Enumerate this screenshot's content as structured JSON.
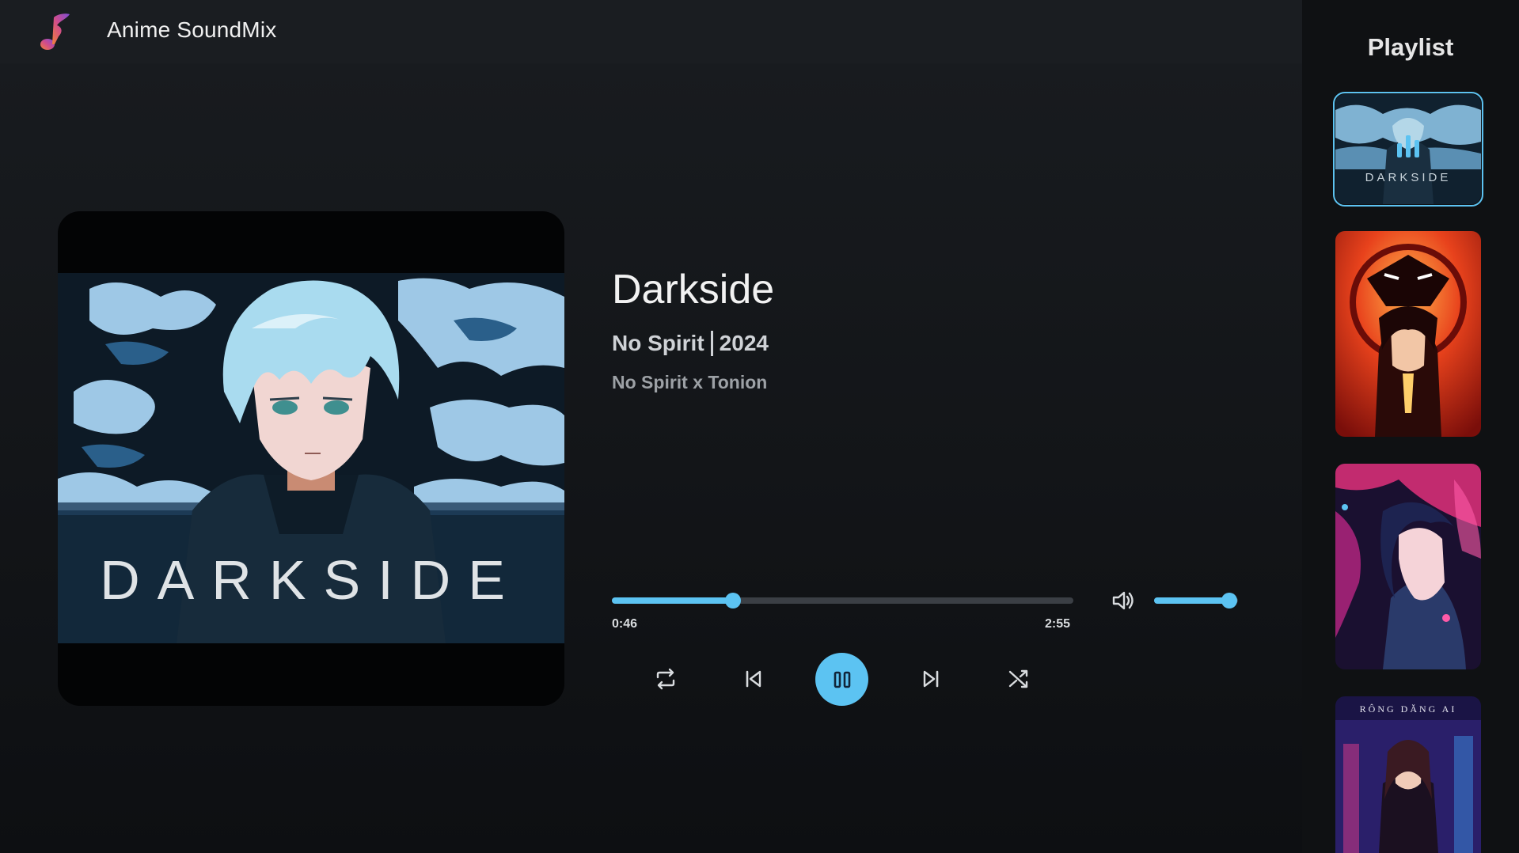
{
  "app": {
    "title": "Anime SoundMix"
  },
  "track": {
    "title": "Darkside",
    "artist": "No Spirit",
    "year": "2024",
    "credits": "No Spirit x Tonion",
    "cover_text": "DARKSIDE"
  },
  "player": {
    "current_time": "0:46",
    "total_time": "2:55",
    "progress_fraction": 0.263,
    "volume_fraction": 0.9,
    "state": "playing"
  },
  "playlist": {
    "title": "Playlist",
    "items": [
      {
        "cover_text": "DARKSIDE",
        "active": true,
        "now_playing_icon": "equalizer-icon"
      },
      {
        "cover_text": "",
        "active": false
      },
      {
        "cover_text": "",
        "active": false
      },
      {
        "cover_text": "RÔNG DĂNG AI",
        "active": false
      }
    ]
  },
  "icons": {
    "repeat": "repeat-icon",
    "previous": "skip-previous-icon",
    "pause": "pause-icon",
    "next": "skip-next-icon",
    "shuffle": "shuffle-icon",
    "volume": "volume-icon"
  },
  "colors": {
    "accent": "#5cc3f2",
    "background": "#15181c",
    "sidebar": "#0f1113"
  }
}
